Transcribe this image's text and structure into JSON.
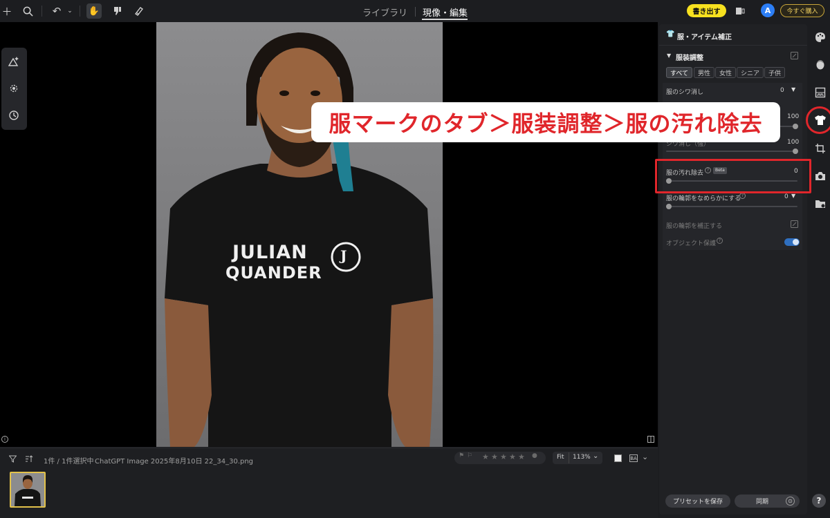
{
  "topbar": {
    "mode_tabs": [
      {
        "label": "ライブラリ",
        "active": false
      },
      {
        "label": "現像・編集",
        "active": true
      }
    ],
    "export_label": "書き出す",
    "avatar_letter": "A",
    "buy_label": "今すぐ購入"
  },
  "photo": {
    "shirt_line1": "JULIAN",
    "shirt_line2": "QUANDER",
    "shirt_logo": "J"
  },
  "filmstrip": {
    "count_text": "1件 / 1件選択中",
    "filename": "ChatGPT Image 2025年8月10日 22_34_30.png",
    "fit_label": "Fit",
    "zoom_label": "113%",
    "rating_stars": 0
  },
  "panel": {
    "title": "服・アイテム補正",
    "section_title": "服装調整",
    "filter_chips": [
      {
        "label": "すべて",
        "active": true
      },
      {
        "label": "男性",
        "active": false
      },
      {
        "label": "女性",
        "active": false
      },
      {
        "label": "シニア",
        "active": false
      },
      {
        "label": "子供",
        "active": false
      }
    ],
    "sliders": {
      "wrinkle_removal": {
        "label": "服のシワ消し",
        "value": "0"
      },
      "hidden_slider_value": "100",
      "wrinkle_strong": {
        "label": "シワ消し（強）",
        "value": "100"
      },
      "stain_removal": {
        "label": "服の汚れ除去",
        "badge": "Beta",
        "value": "0"
      },
      "smooth_outline": {
        "label": "服の輪郭をなめらかにする",
        "value": "0"
      }
    },
    "correct_outline_label": "服の輪郭を補正する",
    "object_protect_label": "オブジェクト保護",
    "preset_save_label": "プリセットを保存",
    "sync_label": "同期"
  },
  "annotation": {
    "text": "服マークのタブ＞服装調整＞服の汚れ除去"
  },
  "colors": {
    "accent_red": "#e0262b",
    "export_yellow": "#f7e11f",
    "toggle_blue": "#2f6fc0"
  }
}
